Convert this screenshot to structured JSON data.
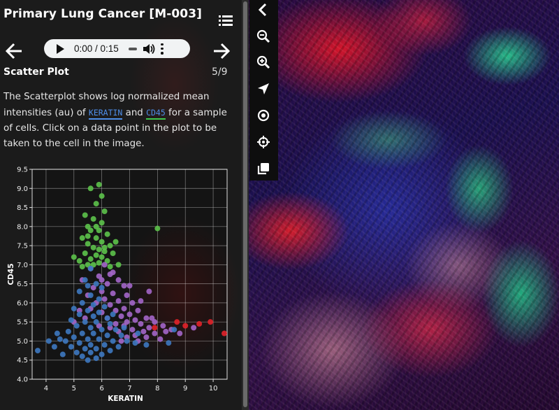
{
  "story": {
    "title": "Primary Lung Cancer [M-003]",
    "audio": {
      "time": "0:00 / 0:15"
    },
    "section_title": "Scatter Plot",
    "page": "5/9",
    "description": {
      "part1": "The Scatterplot shows log normalized mean intensities (au) of ",
      "marker1": "KERATIN",
      "part2": " and ",
      "marker2": "CD45",
      "part3": " for a sample of cells. Click on a data point in the plot to be taken to the cell in the image."
    }
  },
  "toolbar": {
    "items": [
      "collapse-icon",
      "zoom-out-icon",
      "zoom-in-icon",
      "navigate-icon",
      "target-icon",
      "crosshair-icon",
      "layers-icon"
    ]
  },
  "chart_data": {
    "type": "scatter",
    "xlabel": "KERATIN",
    "ylabel": "CD45",
    "xlim": [
      3.5,
      10.5
    ],
    "ylim": [
      4.0,
      9.5
    ],
    "xticks": [
      "4",
      "5",
      "6",
      "7",
      "8",
      "9",
      "10"
    ],
    "yticks": [
      "4.0",
      "4.5",
      "5.0",
      "5.5",
      "6.0",
      "6.5",
      "7.0",
      "7.5",
      "8.0",
      "8.5",
      "9.0",
      "9.5"
    ],
    "grid": true,
    "legend": "none",
    "colors": {
      "green": "#5cc24a",
      "purple": "#a366c9",
      "blue": "#3d78c0",
      "red": "#e2222a"
    },
    "series": [
      {
        "color": "green",
        "points": [
          [
            5.6,
            9.0
          ],
          [
            5.9,
            9.1
          ],
          [
            6.0,
            8.8
          ],
          [
            5.8,
            8.6
          ],
          [
            6.1,
            8.4
          ],
          [
            5.4,
            8.3
          ],
          [
            5.7,
            8.2
          ],
          [
            6.0,
            8.1
          ],
          [
            5.5,
            8.0
          ],
          [
            5.9,
            7.9
          ],
          [
            8.0,
            7.95
          ],
          [
            5.6,
            7.9
          ],
          [
            6.2,
            7.8
          ],
          [
            5.3,
            7.7
          ],
          [
            5.8,
            7.7
          ],
          [
            6.0,
            7.6
          ],
          [
            5.5,
            7.55
          ],
          [
            6.3,
            7.5
          ],
          [
            5.7,
            7.45
          ],
          [
            5.9,
            7.4
          ],
          [
            6.1,
            7.35
          ],
          [
            5.4,
            7.3
          ],
          [
            6.4,
            7.3
          ],
          [
            5.8,
            7.25
          ],
          [
            6.0,
            7.2
          ],
          [
            5.6,
            7.15
          ],
          [
            5.2,
            7.1
          ],
          [
            6.2,
            7.1
          ],
          [
            5.9,
            7.05
          ],
          [
            5.5,
            7.0
          ],
          [
            6.6,
            7.0
          ],
          [
            5.7,
            7.0
          ],
          [
            6.3,
            6.95
          ],
          [
            5.0,
            7.2
          ],
          [
            5.3,
            6.95
          ],
          [
            6.1,
            7.45
          ],
          [
            5.8,
            8.0
          ],
          [
            5.5,
            7.75
          ],
          [
            6.5,
            7.6
          ]
        ]
      },
      {
        "color": "purple",
        "points": [
          [
            6.1,
            7.0
          ],
          [
            6.4,
            6.8
          ],
          [
            5.9,
            6.7
          ],
          [
            6.6,
            6.6
          ],
          [
            6.2,
            6.5
          ],
          [
            5.7,
            6.4
          ],
          [
            6.8,
            6.45
          ],
          [
            6.0,
            6.3
          ],
          [
            6.4,
            6.25
          ],
          [
            5.5,
            6.2
          ],
          [
            6.9,
            6.2
          ],
          [
            6.1,
            6.1
          ],
          [
            6.6,
            6.05
          ],
          [
            5.8,
            6.0
          ],
          [
            7.1,
            6.0
          ],
          [
            6.3,
            5.95
          ],
          [
            6.8,
            5.85
          ],
          [
            5.6,
            5.85
          ],
          [
            6.5,
            5.8
          ],
          [
            7.3,
            5.8
          ],
          [
            6.0,
            5.75
          ],
          [
            7.0,
            5.7
          ],
          [
            6.7,
            5.65
          ],
          [
            7.6,
            5.6
          ],
          [
            6.2,
            5.6
          ],
          [
            7.2,
            5.55
          ],
          [
            6.9,
            5.5
          ],
          [
            7.9,
            5.5
          ],
          [
            6.5,
            5.45
          ],
          [
            7.4,
            5.45
          ],
          [
            8.2,
            5.4
          ],
          [
            6.8,
            5.4
          ],
          [
            7.7,
            5.35
          ],
          [
            6.3,
            5.35
          ],
          [
            7.1,
            5.3
          ],
          [
            8.5,
            5.3
          ],
          [
            7.5,
            5.25
          ],
          [
            6.6,
            5.25
          ],
          [
            7.9,
            5.2
          ],
          [
            7.2,
            5.15
          ],
          [
            8.8,
            5.2
          ],
          [
            6.9,
            5.1
          ],
          [
            7.6,
            5.1
          ],
          [
            8.1,
            5.05
          ],
          [
            7.3,
            5.0
          ],
          [
            6.7,
            5.0
          ],
          [
            5.4,
            5.6
          ],
          [
            5.2,
            5.8
          ],
          [
            5.0,
            5.5
          ],
          [
            5.3,
            6.6
          ],
          [
            7.0,
            6.45
          ],
          [
            7.7,
            6.3
          ],
          [
            6.0,
            6.6
          ],
          [
            7.4,
            6.05
          ],
          [
            5.9,
            5.4
          ],
          [
            8.3,
            5.25
          ],
          [
            9.3,
            5.35
          ],
          [
            7.8,
            5.6
          ],
          [
            5.6,
            6.9
          ],
          [
            6.3,
            6.75
          ]
        ]
      },
      {
        "color": "blue",
        "points": [
          [
            5.6,
            6.9
          ],
          [
            5.4,
            6.6
          ],
          [
            5.8,
            6.5
          ],
          [
            5.2,
            6.3
          ],
          [
            5.6,
            6.2
          ],
          [
            5.9,
            6.1
          ],
          [
            5.3,
            6.0
          ],
          [
            5.7,
            5.95
          ],
          [
            6.1,
            5.9
          ],
          [
            5.0,
            5.85
          ],
          [
            5.5,
            5.8
          ],
          [
            5.9,
            5.75
          ],
          [
            5.2,
            5.7
          ],
          [
            5.7,
            5.65
          ],
          [
            6.2,
            5.6
          ],
          [
            4.9,
            5.55
          ],
          [
            5.4,
            5.5
          ],
          [
            5.8,
            5.5
          ],
          [
            6.3,
            5.45
          ],
          [
            5.1,
            5.4
          ],
          [
            5.6,
            5.35
          ],
          [
            6.0,
            5.3
          ],
          [
            6.5,
            5.3
          ],
          [
            4.8,
            5.25
          ],
          [
            5.3,
            5.2
          ],
          [
            5.7,
            5.2
          ],
          [
            6.2,
            5.15
          ],
          [
            6.7,
            5.15
          ],
          [
            5.0,
            5.1
          ],
          [
            5.5,
            5.05
          ],
          [
            5.9,
            5.05
          ],
          [
            6.4,
            5.0
          ],
          [
            6.9,
            5.0
          ],
          [
            4.7,
            5.0
          ],
          [
            5.2,
            4.95
          ],
          [
            5.6,
            4.9
          ],
          [
            6.1,
            4.9
          ],
          [
            6.6,
            4.85
          ],
          [
            4.9,
            4.85
          ],
          [
            5.4,
            4.8
          ],
          [
            5.8,
            4.8
          ],
          [
            6.3,
            4.75
          ],
          [
            5.1,
            4.7
          ],
          [
            5.6,
            4.7
          ],
          [
            6.0,
            4.65
          ],
          [
            5.3,
            4.6
          ],
          [
            5.8,
            4.55
          ],
          [
            5.5,
            4.5
          ],
          [
            4.5,
            5.05
          ],
          [
            4.3,
            4.85
          ],
          [
            4.1,
            5.0
          ],
          [
            3.7,
            4.75
          ],
          [
            4.6,
            4.65
          ],
          [
            7.2,
            4.95
          ],
          [
            7.6,
            4.9
          ],
          [
            8.4,
            4.95
          ],
          [
            8.6,
            5.3
          ],
          [
            6.0,
            6.4
          ],
          [
            5.5,
            6.45
          ],
          [
            6.4,
            5.7
          ],
          [
            4.4,
            5.2
          ],
          [
            6.8,
            5.35
          ],
          [
            7.3,
            5.2
          ]
        ]
      },
      {
        "color": "red",
        "points": [
          [
            8.7,
            5.5
          ],
          [
            9.5,
            5.45
          ],
          [
            9.9,
            5.5
          ],
          [
            10.4,
            5.2
          ],
          [
            7.9,
            5.35
          ],
          [
            9.0,
            5.4
          ]
        ]
      }
    ]
  }
}
